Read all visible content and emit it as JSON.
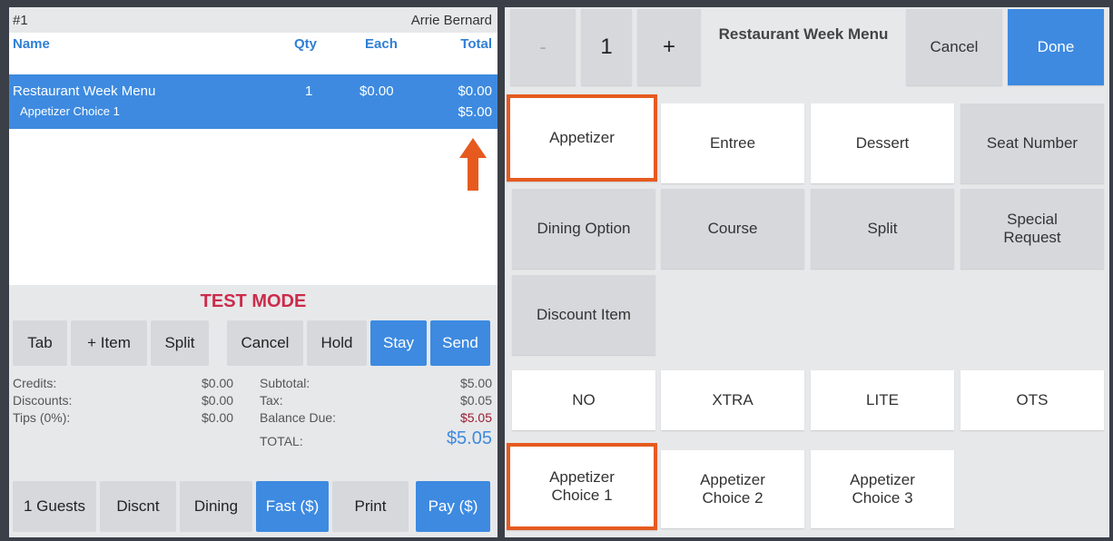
{
  "order": {
    "number": "#1",
    "customer": "Arrie Bernard",
    "columns": {
      "name": "Name",
      "qty": "Qty",
      "each": "Each",
      "total": "Total"
    },
    "items": [
      {
        "name": "Restaurant Week Menu",
        "qty": "1",
        "each": "$0.00",
        "total": "$0.00",
        "modifier": "Appetizer Choice 1",
        "modifier_total": "$5.00"
      }
    ],
    "mode_banner": "TEST MODE"
  },
  "actions": {
    "tab": "Tab",
    "add_item": "+ Item",
    "split": "Split",
    "cancel": "Cancel",
    "hold": "Hold",
    "stay": "Stay",
    "send": "Send"
  },
  "totals": {
    "credits_label": "Credits:",
    "credits": "$0.00",
    "discounts_label": "Discounts:",
    "discounts": "$0.00",
    "tips_label": "Tips (0%):",
    "tips": "$0.00",
    "subtotal_label": "Subtotal:",
    "subtotal": "$5.00",
    "tax_label": "Tax:",
    "tax": "$0.05",
    "balance_label": "Balance Due:",
    "balance": "$5.05",
    "total_label": "TOTAL:",
    "total": "$5.05"
  },
  "bottom": {
    "guests": "1 Guests",
    "discnt": "Discnt",
    "dining": "Dining",
    "fast": "Fast ($)",
    "print": "Print",
    "pay": "Pay ($)"
  },
  "editor": {
    "minus": "-",
    "quantity": "1",
    "plus": "+",
    "title": "Restaurant Week Menu",
    "cancel": "Cancel",
    "done": "Done"
  },
  "categories": [
    "Appetizer",
    "Entree",
    "Dessert",
    "Seat Number",
    "Dining Option",
    "Course",
    "Split",
    "Special Request",
    "Discount Item"
  ],
  "modifiers": [
    "NO",
    "XTRA",
    "LITE",
    "OTS"
  ],
  "choices": [
    "Appetizer Choice 1",
    "Appetizer Choice 2",
    "Appetizer Choice 3"
  ],
  "colors": {
    "accent": "#3d8ae0",
    "highlight": "#e65a1f",
    "alert": "#cc2b4a",
    "balance": "#9b1b30"
  }
}
